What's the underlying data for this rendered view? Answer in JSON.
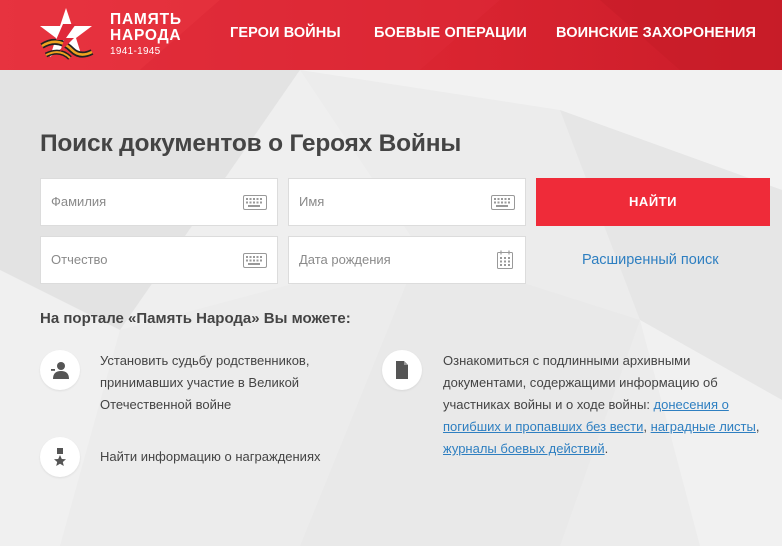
{
  "header": {
    "logo": {
      "line1": "ПАМЯТЬ",
      "line2": "НАРОДА",
      "years": "1941-1945"
    },
    "nav": [
      {
        "label": "ГЕРОИ ВОЙНЫ"
      },
      {
        "label": "БОЕВЫЕ ОПЕРАЦИИ"
      },
      {
        "label": "ВОИНСКИЕ ЗАХОРОНЕНИЯ"
      }
    ]
  },
  "search": {
    "title": "Поиск документов о Героях Войны",
    "fields": {
      "last_name": {
        "placeholder": "Фамилия",
        "value": ""
      },
      "first_name": {
        "placeholder": "Имя",
        "value": ""
      },
      "patronymic": {
        "placeholder": "Отчество",
        "value": ""
      },
      "birth_date": {
        "placeholder": "Дата рождения",
        "value": ""
      }
    },
    "submit_label": "НАЙТИ",
    "advanced_label": "Расширенный поиск"
  },
  "features": {
    "heading": "На портале «Память Народа» Вы можете:",
    "fate": {
      "line1": "Установить судьбу родственников,",
      "line2": "принимавших участие в Великой",
      "line3": "Отечественной войне"
    },
    "awards": {
      "text": "Найти информацию о награждениях"
    },
    "archives": {
      "line1": "Ознакомиться с подлинными архивными",
      "line2": "документами, содержащими информацию об",
      "line3_prefix": "участниках войны и о ходе войны: ",
      "link1_part1": "донесения о",
      "link1_part2": "погибших и пропавших без вести",
      "sep1": ", ",
      "link2": "наградные листы",
      "sep2": ",",
      "link3": "журналы боевых действий",
      "end": "."
    }
  },
  "colors": {
    "header_red": "#e0293a",
    "button_red": "#ef2b39",
    "link_blue": "#2e7fc1",
    "title_gray": "#444444",
    "background": "#ececec"
  },
  "icons": {
    "logo": "star-ribbon-logo",
    "keyboard": "keyboard-icon",
    "calendar": "calendar-icon",
    "person": "person-icon",
    "document": "document-icon",
    "medal": "medal-icon"
  }
}
